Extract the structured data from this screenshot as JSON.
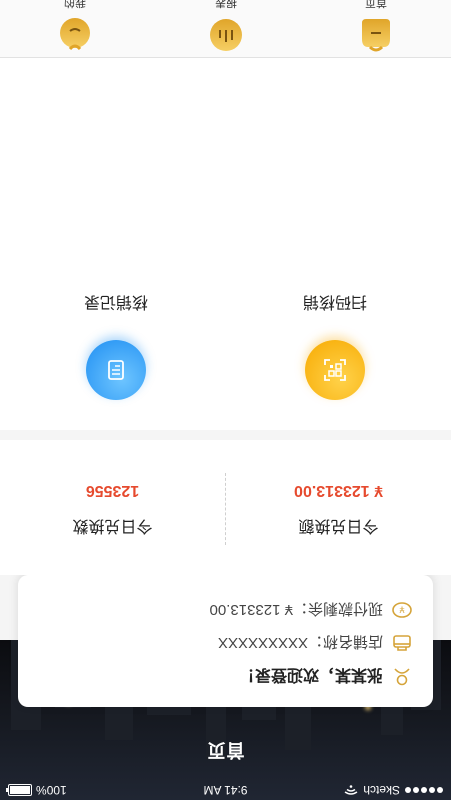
{
  "status_bar": {
    "carrier": "Sketch",
    "time": "9:41 AM",
    "battery": "100%"
  },
  "header": {
    "title": "首页"
  },
  "welcome": {
    "greeting": "张某某，欢迎登录！",
    "shop_label": "店铺名称：",
    "shop_value": "XXXXXXXXX",
    "balance_label": "现付款剩余：",
    "balance_value": "¥ 123313.00"
  },
  "stats": {
    "amount_label": "今日兑换额",
    "amount_value": "¥ 123313.00",
    "count_label": "今日兑换数",
    "count_value": "123556"
  },
  "actions": {
    "scan_label": "扫码核销",
    "record_label": "核销记录"
  },
  "tabbar": {
    "home": "首页",
    "report": "报表",
    "mine": "我的"
  },
  "colors": {
    "accent_gold": "#f7a900",
    "accent_blue": "#1e8ef2",
    "value_red": "#e64a2e"
  }
}
